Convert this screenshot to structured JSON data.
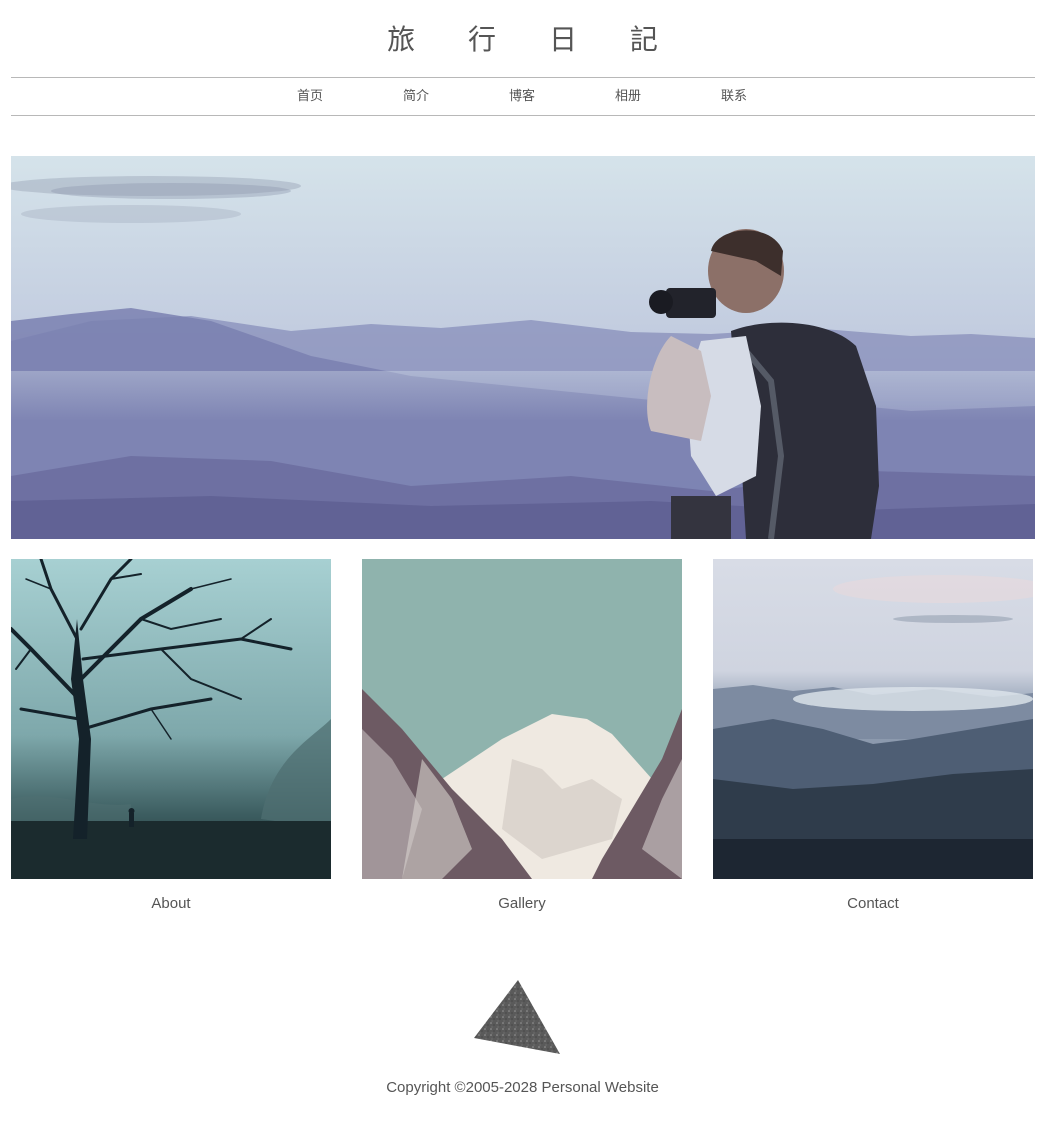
{
  "site": {
    "title": "旅 行 日 記"
  },
  "nav": {
    "items": [
      {
        "label": "首页"
      },
      {
        "label": "简介"
      },
      {
        "label": "博客"
      },
      {
        "label": "相册"
      },
      {
        "label": "联系"
      }
    ]
  },
  "hero": {
    "image": "photographer-on-mountain-photo"
  },
  "cards": [
    {
      "label": "About",
      "image": "misty-tree-photo"
    },
    {
      "label": "Gallery",
      "image": "snowy-peak-photo"
    },
    {
      "label": "Contact",
      "image": "mountain-range-photo"
    }
  ],
  "footer": {
    "logo": "triangle-logo",
    "copyright": "Copyright ©2005-2028 Personal Website"
  },
  "colors": {
    "text": "#555555",
    "divider": "#b8b8b8"
  }
}
